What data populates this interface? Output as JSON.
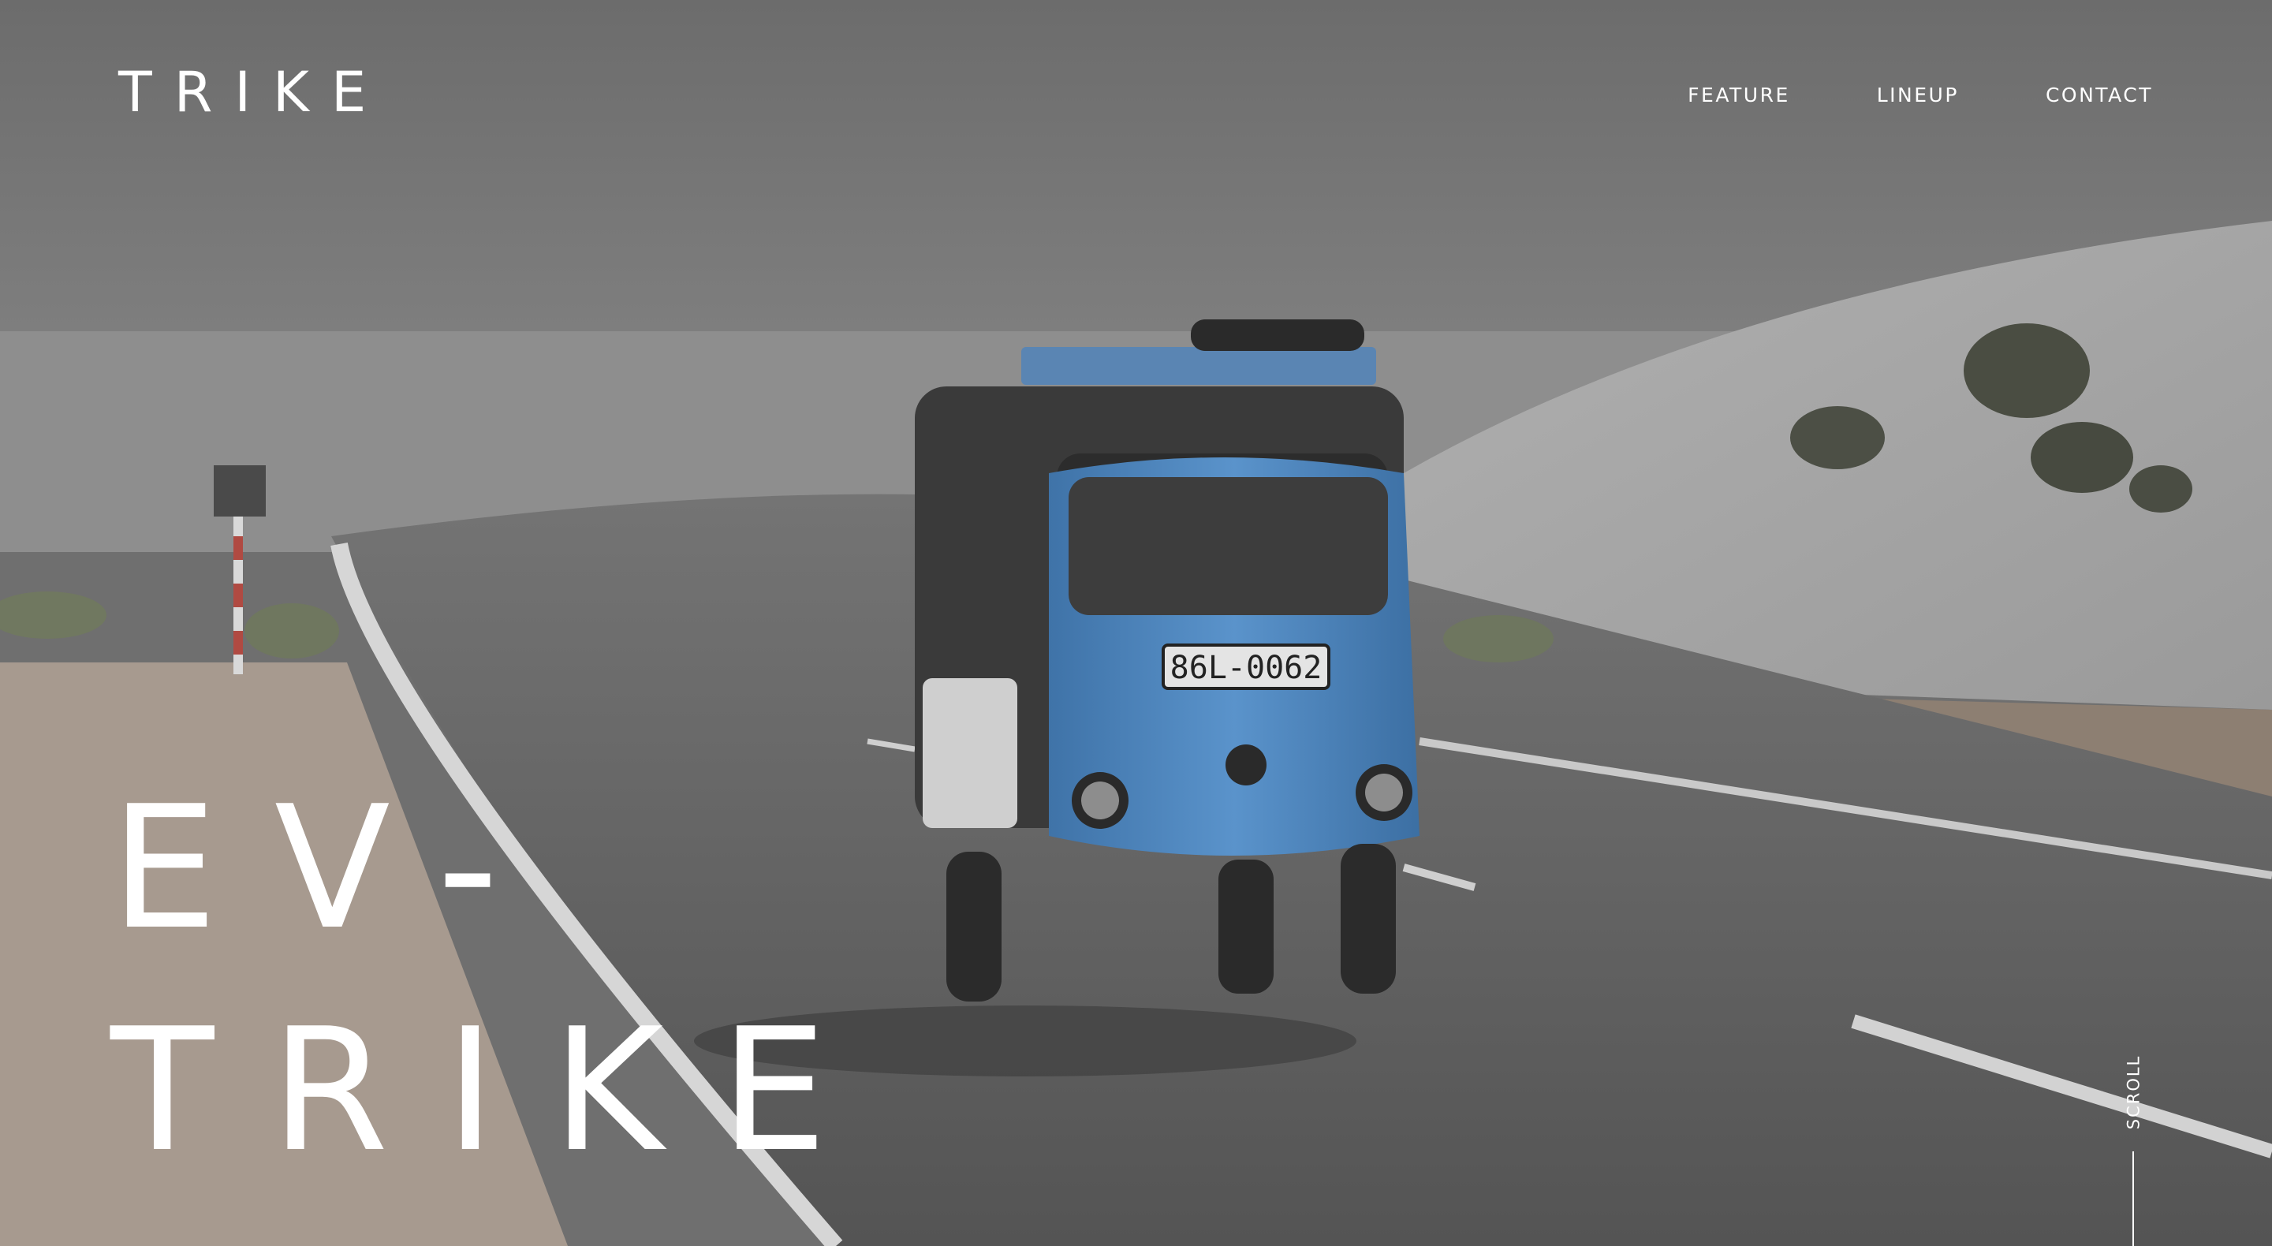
{
  "brand": {
    "logo_text": "TRIKE"
  },
  "nav": {
    "items": [
      "FEATURE",
      "LINEUP",
      "CONTACT"
    ]
  },
  "hero": {
    "headline_line1": "EV-",
    "headline_line2": "TRIKE",
    "plate_text": "86L-0062",
    "scroll_label": "SCROLL"
  },
  "colors": {
    "overlay": "#6f6f6f",
    "text": "#ffffff",
    "trike_blue": "#4f86bf",
    "road": "#5b5b5b"
  }
}
